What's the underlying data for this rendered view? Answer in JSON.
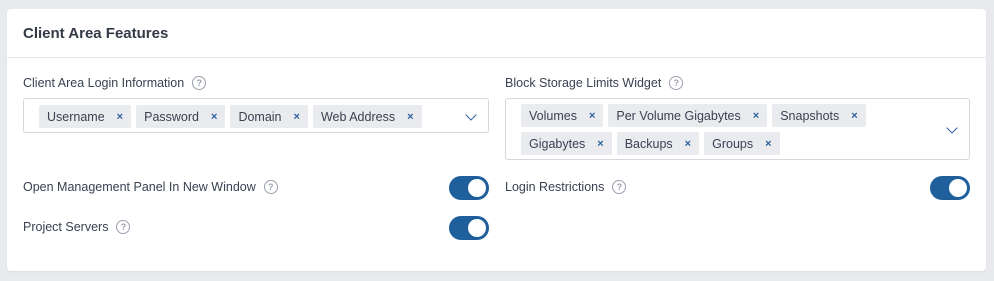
{
  "panel": {
    "title": "Client Area Features"
  },
  "login_info": {
    "label": "Client Area Login Information",
    "help_icon": "question-circle-icon",
    "tags": [
      "Username",
      "Password",
      "Domain",
      "Web Address"
    ],
    "remove_glyph": "×"
  },
  "block_storage": {
    "label": "Block Storage Limits Widget",
    "help_icon": "question-circle-icon",
    "tags_row1": [
      "Volumes",
      "Per Volume Gigabytes",
      "Snapshots"
    ],
    "tags_row2": [
      "Gigabytes",
      "Backups",
      "Groups"
    ],
    "remove_glyph": "×"
  },
  "toggles": {
    "open_panel_new_window": {
      "label": "Open Management Panel In New Window",
      "on": true
    },
    "login_restrictions": {
      "label": "Login Restrictions",
      "on": true
    },
    "project_servers": {
      "label": "Project Servers",
      "on": true
    }
  },
  "colors": {
    "accent": "#1f5f9c",
    "tag_bg": "#e9ebef",
    "page_bg": "#e9eaee"
  }
}
